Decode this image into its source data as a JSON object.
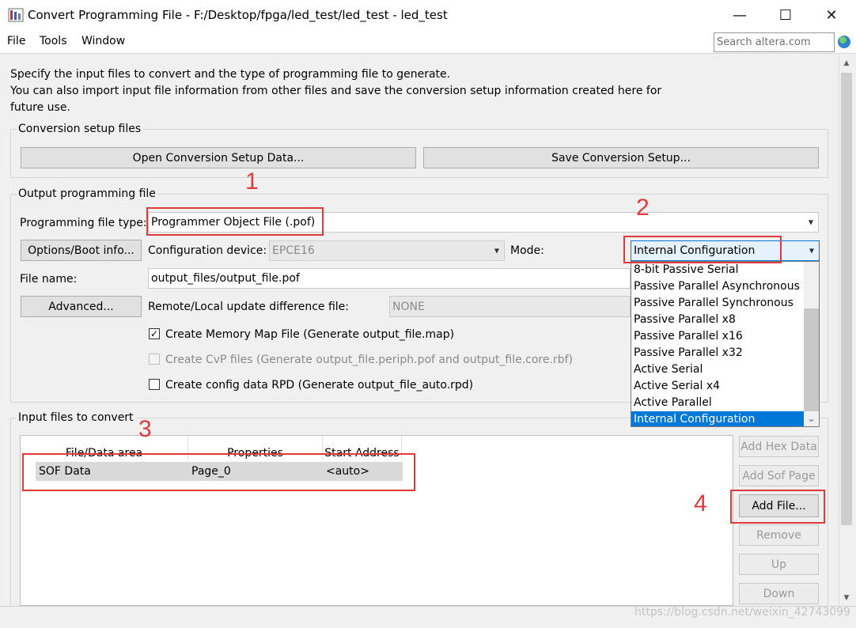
{
  "window": {
    "title": "Convert Programming File - F:/Desktop/fpga/led_test/led_test - led_test",
    "minimize": "—",
    "maximize": "☐",
    "close": "✕"
  },
  "menu": [
    "File",
    "Tools",
    "Window"
  ],
  "search": {
    "placeholder": "Search altera.com"
  },
  "intro": [
    "Specify the input files to convert and the type of programming file to generate.",
    "You can also import input file information from other files and save the conversion setup information created here for",
    "future use."
  ],
  "conversion_setup": {
    "title": "Conversion setup files",
    "open_button": "Open Conversion Setup Data...",
    "save_button": "Save Conversion Setup..."
  },
  "output": {
    "title": "Output programming file",
    "file_type_label": "Programming file type:",
    "file_type_value": "Programmer Object File (.pof)",
    "options_button": "Options/Boot info...",
    "config_device_label": "Configuration device:",
    "config_device_value": "EPCE16",
    "mode_label": "Mode:",
    "mode_value": "Internal Configuration",
    "file_name_label": "File name:",
    "file_name_value": "output_files/output_file.pof",
    "advanced_button": "Advanced...",
    "remote_label": "Remote/Local update difference file:",
    "remote_value": "NONE",
    "checkboxes": [
      {
        "label": "Create Memory Map File (Generate output_file.map)",
        "checked": true,
        "enabled": true
      },
      {
        "label": "Create CvP files (Generate output_file.periph.pof and output_file.core.rbf)",
        "checked": false,
        "enabled": false
      },
      {
        "label": "Create config data RPD (Generate output_file_auto.rpd)",
        "checked": false,
        "enabled": true
      }
    ]
  },
  "mode_options": [
    "8-bit Passive Serial",
    "Passive Parallel Asynchronous",
    "Passive Parallel Synchronous",
    "Passive Parallel x8",
    "Passive Parallel x16",
    "Passive Parallel x32",
    "Active Serial",
    "Active Serial x4",
    "Active Parallel",
    "Internal Configuration"
  ],
  "input": {
    "title": "Input files to convert",
    "columns": [
      "File/Data area",
      "Properties",
      "Start Address"
    ],
    "rows": [
      [
        "SOF Data",
        "Page_0",
        "<auto>"
      ]
    ],
    "buttons": {
      "add_hex": "Add Hex Data",
      "add_sof": "Add Sof Page",
      "add_file": "Add File...",
      "remove": "Remove",
      "up": "Up",
      "down": "Down"
    }
  },
  "annotations": [
    "1",
    "2",
    "3",
    "4"
  ],
  "watermark": "https://blog.csdn.net/weixin_42743099",
  "colors": {
    "annotation": "#e03a3a",
    "selection": "#0078d7"
  }
}
